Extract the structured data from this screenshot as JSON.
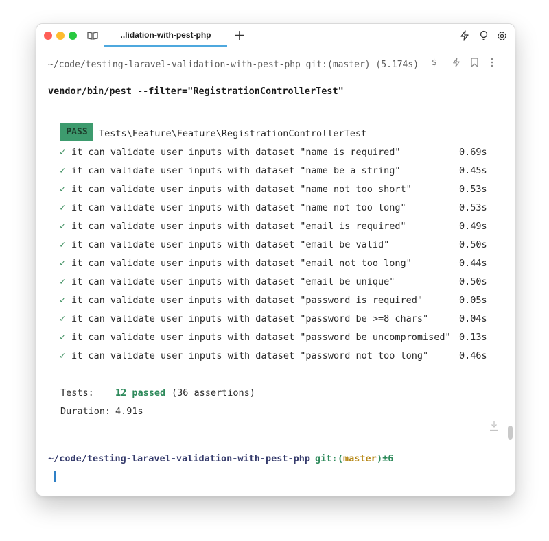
{
  "window": {
    "tab_title": "..lidation-with-pest-php",
    "new_tab": "+"
  },
  "block": {
    "header": "~/code/testing-laravel-validation-with-pest-php git:(master) (5.174s)",
    "command": "vendor/bin/pest --filter=\"RegistrationControllerTest\"",
    "header_icons": [
      "terminal-icon",
      "bolt-icon",
      "bookmark-icon",
      "more-icon"
    ]
  },
  "output": {
    "pass_badge": "PASS",
    "suite_name": "Tests\\Feature\\Feature\\RegistrationControllerTest",
    "check_mark": "✓",
    "tests": [
      {
        "name": "it can validate user inputs with dataset \"name is required\"",
        "time": "0.69s"
      },
      {
        "name": "it can validate user inputs with dataset \"name be a string\"",
        "time": "0.45s"
      },
      {
        "name": "it can validate user inputs with dataset \"name not too short\"",
        "time": "0.53s"
      },
      {
        "name": "it can validate user inputs with dataset \"name not too long\"",
        "time": "0.53s"
      },
      {
        "name": "it can validate user inputs with dataset \"email is required\"",
        "time": "0.49s"
      },
      {
        "name": "it can validate user inputs with dataset \"email be valid\"",
        "time": "0.50s"
      },
      {
        "name": "it can validate user inputs with dataset \"email not too long\"",
        "time": "0.44s"
      },
      {
        "name": "it can validate user inputs with dataset \"email be unique\"",
        "time": "0.50s"
      },
      {
        "name": "it can validate user inputs with dataset \"password is required\"",
        "time": "0.05s"
      },
      {
        "name": "it can validate user inputs with dataset \"password be >=8 chars\"",
        "time": "0.04s"
      },
      {
        "name": "it can validate user inputs with dataset \"password be uncompromised\"",
        "time": "0.13s"
      },
      {
        "name": "it can validate user inputs with dataset \"password not too long\"",
        "time": "0.46s"
      }
    ],
    "summary": {
      "tests_label": "Tests:",
      "passed": "12 passed",
      "assertions": "(36 assertions)",
      "duration_label": "Duration:",
      "duration": "4.91s"
    }
  },
  "prompt": {
    "path": "~/code/testing-laravel-validation-with-pest-php",
    "git_label": "git:",
    "paren_open": "(",
    "branch": "master",
    "paren_close_dirty": ")±6"
  },
  "colors": {
    "pass_badge": "#3d9b6e",
    "success": "#2e8a5b",
    "prompt_path": "#343a6b",
    "branch": "#b88a1a",
    "cursor": "#2f80c6",
    "tab_accent": "#4ea8de"
  }
}
